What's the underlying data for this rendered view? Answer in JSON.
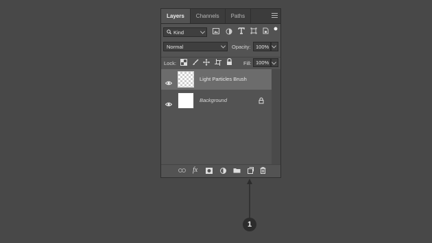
{
  "tabs": [
    {
      "label": "Layers",
      "active": true
    },
    {
      "label": "Channels",
      "active": false
    },
    {
      "label": "Paths",
      "active": false
    }
  ],
  "filter": {
    "label": "Kind"
  },
  "blend": {
    "mode": "Normal",
    "opacity_label": "Opacity:",
    "opacity_value": "100%"
  },
  "lock": {
    "label": "Lock:",
    "fill_label": "Fill:",
    "fill_value": "100%"
  },
  "layers": [
    {
      "name": "Light Particles Brush",
      "selected": true,
      "thumbnail": "transparent",
      "locked": false
    },
    {
      "name": "Background",
      "selected": false,
      "thumbnail": "white",
      "locked": true
    }
  ],
  "footer_icons": [
    "link-icon",
    "fx-icon",
    "mask-icon",
    "adjustment-icon",
    "group-folder-icon",
    "new-layer-icon",
    "trash-icon"
  ],
  "callout": {
    "number": "1"
  },
  "colors": {
    "background": "#484848",
    "panel": "#535353",
    "selected_row": "#6c6c6c"
  }
}
